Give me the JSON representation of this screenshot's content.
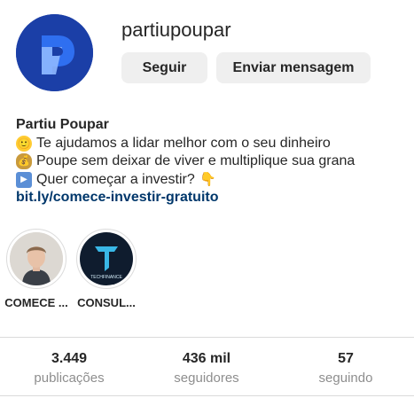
{
  "profile": {
    "username": "partiupoupar",
    "avatar_icon": "partiu-poupar-logo",
    "brand_color": "#1b3fa7"
  },
  "actions": {
    "follow_label": "Seguir",
    "message_label": "Enviar mensagem"
  },
  "bio": {
    "name": "Partiu Poupar",
    "line1_emoji": "🙂",
    "line1_text": "Te ajudamos a lidar melhor com o seu dinheiro",
    "line2_emoji": "💰",
    "line2_text": "Poupe sem deixar de viver e multiplique sua grana",
    "line3_emoji": "▶",
    "line3_text": "Quer começar a investir?",
    "line3_trailing_emoji": "👇",
    "link": "bit.ly/comece-investir-gratuito",
    "link_color": "#00376b"
  },
  "highlights": [
    {
      "label": "COMECE ...",
      "icon": "person-photo"
    },
    {
      "label": "CONSUL...",
      "icon": "techfinance-logo",
      "logo_text": "TECHFINANCE"
    }
  ],
  "stats": [
    {
      "value": "3.449",
      "label": "publicações"
    },
    {
      "value": "436 mil",
      "label": "seguidores"
    },
    {
      "value": "57",
      "label": "seguindo"
    }
  ]
}
